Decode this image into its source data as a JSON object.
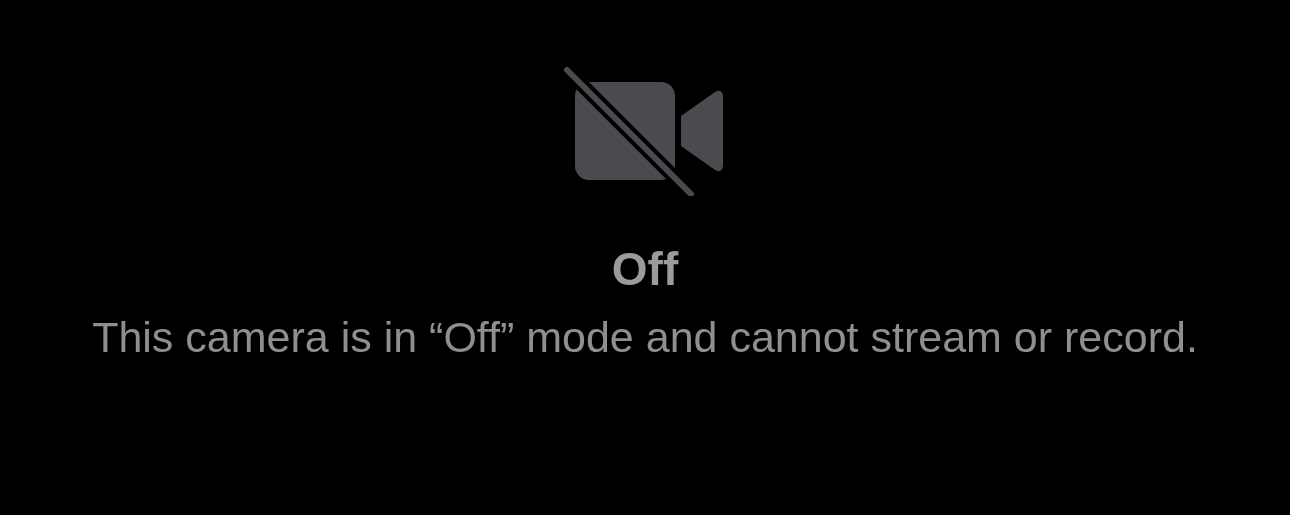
{
  "status": {
    "title": "Off",
    "message": "This camera is in “Off” mode and cannot stream or record."
  }
}
